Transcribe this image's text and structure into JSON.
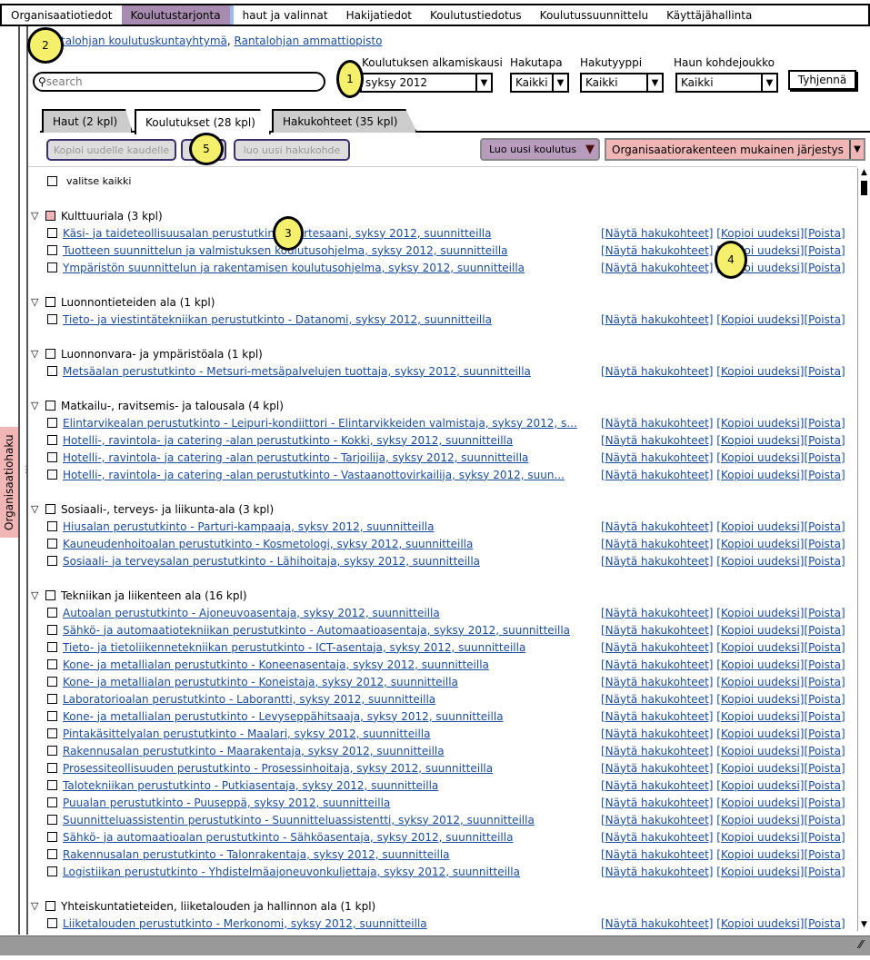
{
  "nav": {
    "tabs": [
      "Organisaatiotiedot",
      "Koulutustarjonta",
      "haut ja valinnat",
      "Hakijatiedot",
      "Koulutustiedotus",
      "Koulutussuunnittelu",
      "Käyttäjähallinta"
    ],
    "active": 1
  },
  "sidebar": {
    "label": "Organisaatiohaku"
  },
  "breadcrumb": {
    "org1": "Rantalohjan koulutuskuntayhtymä",
    "sep": ",",
    "org2": "Rantalohjan ammattiopisto"
  },
  "filters": {
    "search_placeholder": "search",
    "alkamiskausi_label": "Koulutuksen alkamiskausi",
    "alkamiskausi_value": "syksy 2012",
    "hakutapa_label": "Hakutapa",
    "hakutapa_value": "Kaikki",
    "hakutyyppi_label": "Hakutyyppi",
    "hakutyyppi_value": "Kaikki",
    "kohdejoukko_label": "Haun kohdejoukko",
    "kohdejoukko_value": "Kaikki",
    "clear": "Tyhjennä"
  },
  "tabs": [
    "Haut (2 kpl)",
    "Koulutukset (28 kpl)",
    "Hakukohteet (35 kpl)"
  ],
  "toolbar": {
    "copy": "Kopioi uudelle kaudelle",
    "delete": "Poista",
    "new_hakukohde": "luo uusi hakukohde",
    "new_koulutus": "Luo uusi koulutus",
    "sort": "Organisaatiorakenteen mukainen järjestys"
  },
  "select_all": "valitse kaikki",
  "actions": {
    "show": "[Näytä hakukohteet]",
    "copy": "[Kopioi uudeksi]",
    "delete": "[Poista]"
  },
  "annotations": [
    "1",
    "2",
    "3",
    "4",
    "5"
  ],
  "groups": [
    {
      "title": "Kulttuuriala (3 kpl)",
      "items": [
        "Käsi- ja taideteollisuusalan perustutkinto - Artesaani, syksy 2012, suunnitteilla",
        "Tuotteen suunnittelun ja valmistuksen koulutusohjelma, syksy 2012, suunnitteilla",
        "Ympäristön suunnittelun ja rakentamisen koulutusohjelma, syksy 2012, suunnitteilla"
      ]
    },
    {
      "title": "Luonnontieteiden ala (1 kpl)",
      "items": [
        "Tieto- ja viestintätekniikan perustutkinto - Datanomi, syksy 2012, suunnitteilla"
      ]
    },
    {
      "title": "Luonnonvara- ja ympäristöala (1 kpl)",
      "items": [
        "Metsäalan perustutkinto - Metsuri-metsäpalvelujen tuottaja, syksy 2012, suunnitteilla"
      ]
    },
    {
      "title": "Matkailu-, ravitsemis- ja talousala (4 kpl)",
      "items": [
        "Elintarvikealan perustutkinto - Leipuri-kondiittori - Elintarvikkeiden valmistaja, syksy 2012, s...",
        "Hotelli-, ravintola- ja catering -alan perustutkinto - Kokki, syksy 2012, suunnitteilla",
        "Hotelli-, ravintola- ja catering -alan perustutkinto - Tarjoilija, syksy 2012, suunnitteilla",
        "Hotelli-, ravintola- ja catering -alan perustutkinto - Vastaanottovirkailija, syksy 2012, suun..."
      ]
    },
    {
      "title": "Sosiaali-, terveys- ja liikunta-ala (3 kpl)",
      "items": [
        "Hiusalan perustutkinto - Parturi-kampaaja, syksy 2012, suunnitteilla",
        "Kauneudenhoitoalan perustutkinto - Kosmetologi, syksy 2012, suunnitteilla",
        "Sosiaali- ja terveysalan perustutkinto - Lähihoitaja, syksy 2012, suunnitteilla"
      ]
    },
    {
      "title": "Tekniikan ja liikenteen ala (16 kpl)",
      "items": [
        "Autoalan perustutkinto - Ajoneuvoasentaja, syksy 2012, suunnitteilla",
        "Sähkö- ja automaatiotekniikan perustutkinto - Automaatioasentaja, syksy 2012, suunnitteilla",
        "Tieto- ja tietoliikennetekniikan perustutkinto - ICT-asentaja, syksy 2012, suunnitteilla",
        "Kone- ja metallialan perustutkinto - Koneenasentaja, syksy 2012, suunnitteilla",
        "Kone- ja metallialan perustutkinto - Koneistaja, syksy 2012, suunnitteilla",
        "Laboratorioalan perustutkinto - Laborantti, syksy 2012, suunnitteilla",
        "Kone- ja metallialan perustutkinto - Levyseppähitsaaja, syksy 2012, suunnitteilla",
        "Pintakäsittelyalan perustutkinto - Maalari, syksy 2012, suunnitteilla",
        "Rakennusalan perustutkinto - Maarakentaja, syksy 2012, suunnitteilla",
        "Prosessiteollisuuden perustutkinto - Prosessinhoitaja, syksy 2012, suunnitteilla",
        "Talotekniikan perustutkinto - Putkiasentaja, syksy 2012, suunnitteilla",
        "Puualan perustutkinto - Puuseppä, syksy 2012, suunnitteilla",
        "Suunnitteluassistentin perustutkinto - Suunnitteluassistentti, syksy 2012, suunnitteilla",
        "Sähkö- ja automaatioalan perustutkinto - Sähköasentaja, syksy 2012, suunnitteilla",
        "Rakennusalan perustutkinto - Talonrakentaja, syksy 2012, suunnitteilla",
        "Logistiikan perustutkinto - Yhdistelmäajoneuvonkuljettaja, syksy 2012, suunnitteilla"
      ]
    },
    {
      "title": "Yhteiskuntatieteiden, liiketalouden ja hallinnon ala (1 kpl)",
      "items": [
        "Liiketalouden perustutkinto - Merkonomi, syksy 2012, suunnitteilla"
      ]
    }
  ]
}
